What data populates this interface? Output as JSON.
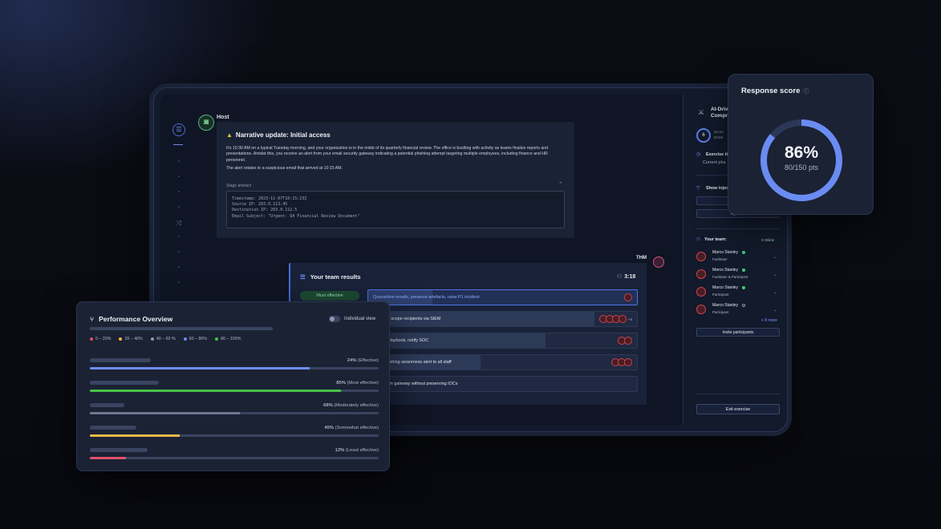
{
  "host": {
    "label": "Host"
  },
  "narrative": {
    "title": "Narrative update: Initial access",
    "paragraph1": "It's 10:30 AM on a typical Tuesday morning, and your organization is in the midst of its quarterly financial review. The office is bustling with activity as teams finalize reports and presentations. Amidst this, you receive an alert from your email security gateway indicating a potential phishing attempt targeting multiple employees, including finance and HR personnel.",
    "paragraph2": "The alert relates to a suspicious email that arrived at 10:15 AM.",
    "artifact_label": "Stage artefact",
    "artifact_lines": [
      "Timestamp: 2023-11-07T10:15:23Z",
      "Source IP: 203.0.113.45",
      "Destination IP: 203.0.112.5",
      "Email Subject: \"Urgent: Q4 Financial Review Document\""
    ]
  },
  "thm": {
    "label": "THM"
  },
  "results": {
    "title": "Your team results",
    "timer": "3:18",
    "badge": "Most effective",
    "options": [
      {
        "text": "Quarantine emails, preserve artefacts, raise P1 incident",
        "fill": 0.24,
        "avatars": 1,
        "more": ""
      },
      {
        "text": "ource IP, scope recipients via SIEM",
        "fill": 0.85,
        "avatars": 4,
        "more": "+4"
      },
      {
        "text": "hishing playbook, notify SOC",
        "fill": 0.68,
        "avatars": 2,
        "more": ""
      },
      {
        "text": "neral phishing awareness alert to all staff",
        "fill": 0.45,
        "avatars": 3,
        "more": ""
      },
      {
        "text": "mails from gateway without preserving IOCs",
        "fill": 0.12,
        "avatars": 0,
        "more": ""
      }
    ]
  },
  "side": {
    "title_line1": "AI-Driven P",
    "title_line2": "Compromis",
    "score_value": "6",
    "score_label": "Score",
    "score_sub": "6/150",
    "timer_label": "Exercise timer",
    "phase": "Current pha",
    "injects_label": "Show injects c",
    "add_btn": "+ Add to",
    "open_btn": "Open re",
    "team_label": "Your team:",
    "online": "3 Online",
    "members": [
      {
        "name": "Marco Stanley",
        "role": "Facilitator",
        "online": true
      },
      {
        "name": "Marco Stanley",
        "role": "Facilitator & Participant",
        "online": true
      },
      {
        "name": "Marco Stanley",
        "role": "Participant",
        "online": true
      },
      {
        "name": "Marco Stanley",
        "role": "Participant",
        "online": false
      }
    ],
    "more_link": "+ 8 more",
    "invite_btn": "Invite participants",
    "exit_btn": "Exit exercise"
  },
  "score_card": {
    "title": "Response score",
    "percent": "86%",
    "points": "80/150 pts",
    "progress": 0.86
  },
  "performance": {
    "title": "Performance Overview",
    "toggle_label": "Individual view",
    "legend": [
      {
        "label": "0 – 20%",
        "color": "#e0506a"
      },
      {
        "label": "20 – 40%",
        "color": "#f2b84b"
      },
      {
        "label": "40 – 60 %",
        "color": "#8e98b3"
      },
      {
        "label": "60 – 80%",
        "color": "#6f8ef0"
      },
      {
        "label": "80 – 100%",
        "color": "#47c24a"
      }
    ],
    "rows": [
      {
        "pct": "24%",
        "desc": "(Effective)",
        "value": 0.76,
        "color": "#6f8ef0",
        "label_w": 0.21
      },
      {
        "pct": "85%",
        "desc": "(Most effective)",
        "value": 0.87,
        "color": "#47c24a",
        "label_w": 0.24
      },
      {
        "pct": "68%",
        "desc": "(Moderately effective)",
        "value": 0.52,
        "color": "#6e7690",
        "label_w": 0.12
      },
      {
        "pct": "45%",
        "desc": "(Somewhat effective)",
        "value": 0.31,
        "color": "#f2b84b",
        "label_w": 0.16
      },
      {
        "pct": "12%",
        "desc": "(Least effective)",
        "value": 0.125,
        "color": "#e0506a",
        "label_w": 0.2
      }
    ]
  }
}
